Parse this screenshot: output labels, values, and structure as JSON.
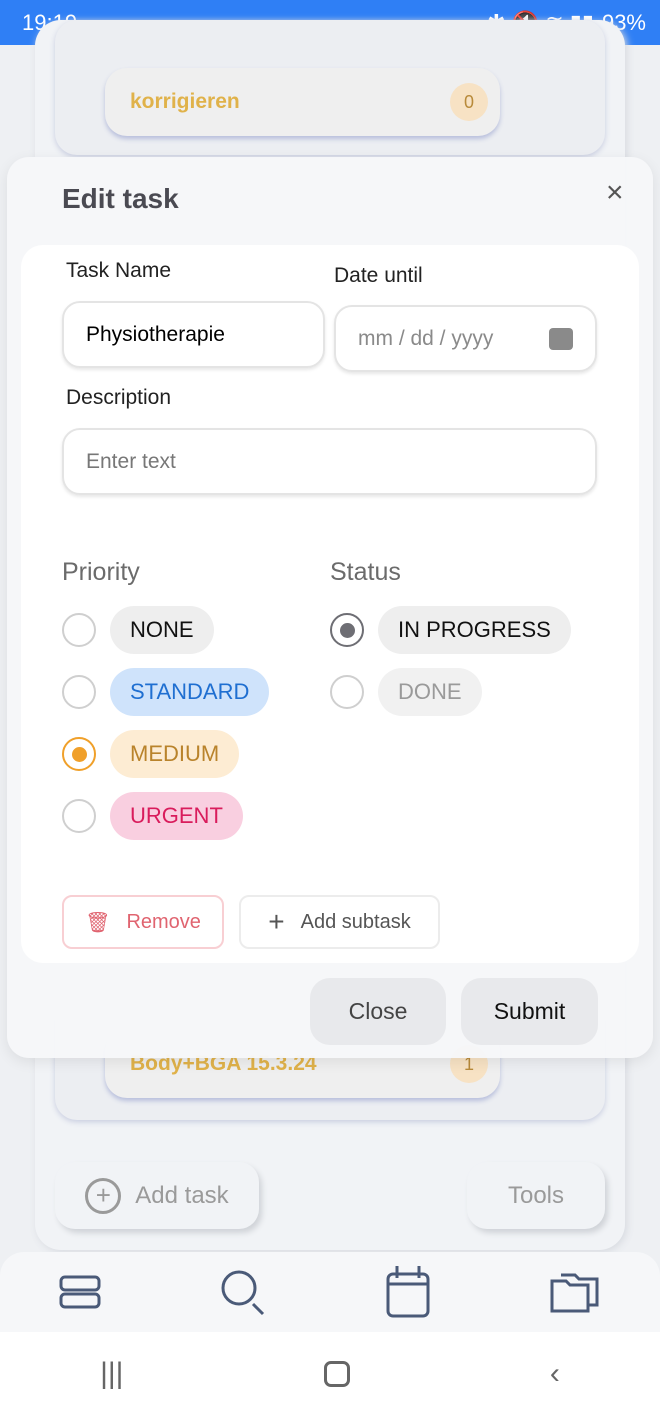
{
  "status_bar": {
    "time": "19:19",
    "battery": "93%"
  },
  "background": {
    "list_item": {
      "label": "korrigieren",
      "count": "0"
    },
    "list_item_2": {
      "label": "Body+BGA 15.3.24",
      "count": "1"
    },
    "add_task": "Add task",
    "tools": "Tools"
  },
  "modal": {
    "title": "Edit task",
    "task_name": {
      "label": "Task Name",
      "value": "Physiotherapie"
    },
    "date_until": {
      "label": "Date until",
      "placeholder": "mm / dd / yyyy"
    },
    "description": {
      "label": "Description",
      "placeholder": "Enter text"
    },
    "priority": {
      "label": "Priority",
      "selected": "MEDIUM",
      "options": [
        {
          "label": "NONE",
          "bg": "#eeeeee",
          "fg": "#111111"
        },
        {
          "label": "STANDARD",
          "bg": "#cfe3fb",
          "fg": "#1f6fd1"
        },
        {
          "label": "MEDIUM",
          "bg": "#fdecd3",
          "fg": "#b9832b"
        },
        {
          "label": "URGENT",
          "bg": "#f9cfe0",
          "fg": "#d91c5c"
        }
      ]
    },
    "status": {
      "label": "Status",
      "selected": "IN PROGRESS",
      "options": [
        {
          "label": "IN PROGRESS",
          "bg": "#eeeeee",
          "fg": "#111111"
        },
        {
          "label": "DONE",
          "bg": "#f1f1f1",
          "fg": "#9a9a9a"
        }
      ]
    },
    "remove": "Remove",
    "add_subtask": "Add subtask",
    "close": "Close",
    "submit": "Submit"
  },
  "colors": {
    "accent": "#f0a02a",
    "status_bar": "#2f7ff5"
  }
}
